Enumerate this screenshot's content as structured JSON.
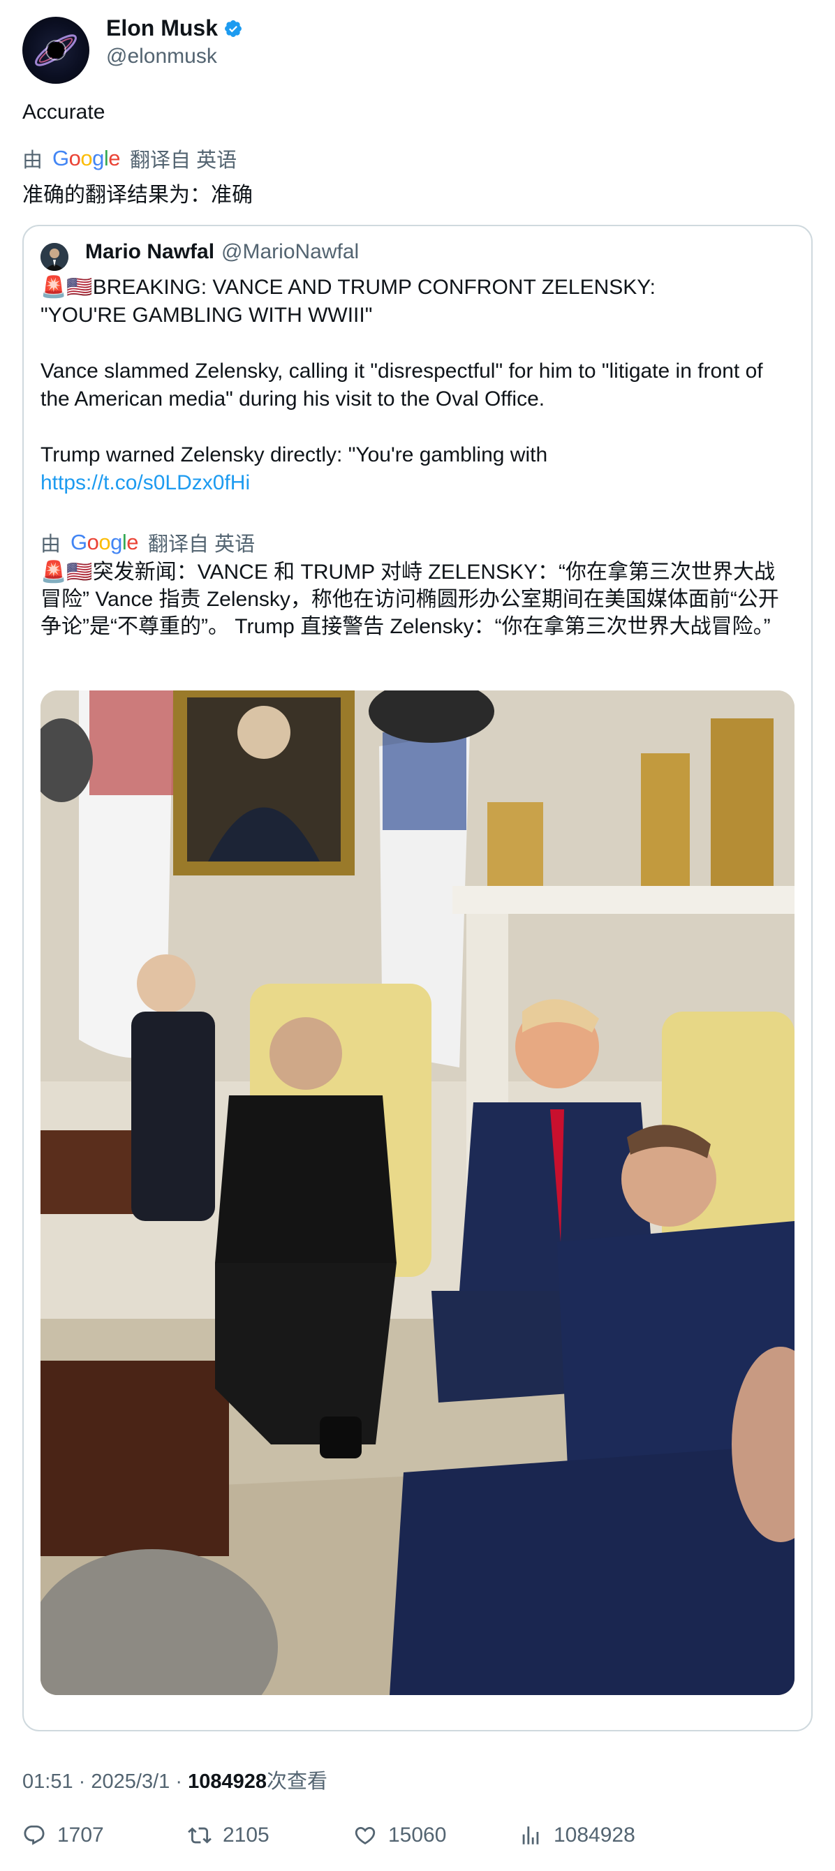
{
  "author": {
    "name": "Elon Musk",
    "handle": "@elonmusk",
    "verified": true,
    "verified_color": "#1d9bf0"
  },
  "tweet": {
    "text": "Accurate",
    "translation": {
      "prefix": "由",
      "google_letters": [
        "G",
        "o",
        "o",
        "g",
        "l",
        "e"
      ],
      "suffix": "翻译自 英语",
      "text": "准确的翻译结果为：准确"
    }
  },
  "quote": {
    "name": "Mario Nawfal",
    "handle": "@MarioNawfal",
    "emoji": "🚨🇺🇸",
    "line1": "BREAKING: VANCE AND TRUMP CONFRONT ZELENSKY:",
    "line2": "\"YOU'RE GAMBLING WITH WWIII\"",
    "para2": "Vance slammed Zelensky, calling it \"disrespectful\" for him to \"litigate in front of the American media\" during his visit to the Oval Office.",
    "para3": "Trump warned Zelensky directly: \"You're gambling with",
    "link": "https://t.co/s0LDzx0fHi",
    "translation": {
      "prefix": "由",
      "suffix": "翻译自 英语",
      "text": "突发新闻：VANCE 和 TRUMP 对峙 ZELENSKY：“你在拿第三次世界大战冒险” Vance 指责 Zelensky，称他在访问椭圆形办公室期间在美国媒体面前“公开争论”是“不尊重的”。 Trump 直接警告 Zelensky：“你在拿第三次世界大战冒险。”"
    }
  },
  "meta": {
    "time": "01:51",
    "sep": "·",
    "date": "2025/3/1",
    "views": "1084928",
    "views_label": "次查看"
  },
  "actions": {
    "replies": "1707",
    "retweets": "2105",
    "likes": "15060",
    "views": "1084928"
  },
  "colors": {
    "text": "#0f1419",
    "secondary": "#536471",
    "link": "#1d9bf0",
    "border": "#cfd9de"
  },
  "icons": [
    "verified-badge-icon",
    "reply-icon",
    "retweet-icon",
    "like-icon",
    "analytics-icon"
  ]
}
